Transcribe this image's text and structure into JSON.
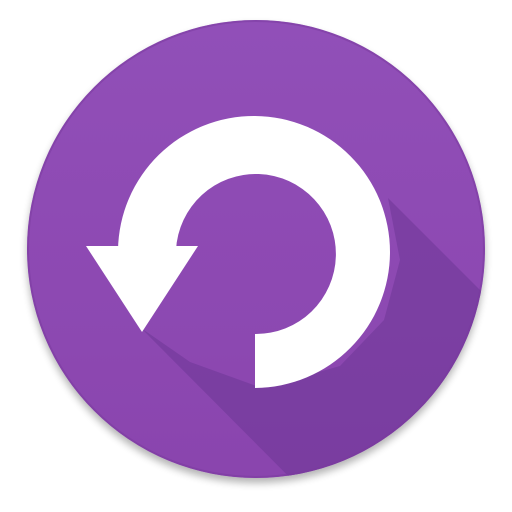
{
  "app_icon": {
    "icon_name": "undo-rotate-icon",
    "colors": {
      "circle_top": "#9150B8",
      "circle_bottom": "#8A44AE",
      "circle_edge": "#7A3A9E",
      "long_shadow": "#6E3795",
      "glyph": "#FFFFFF"
    }
  }
}
